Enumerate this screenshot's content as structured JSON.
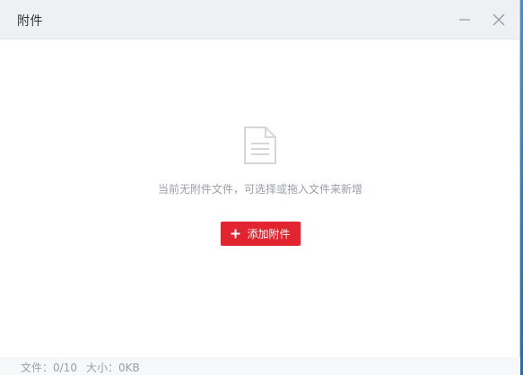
{
  "window": {
    "title": "附件",
    "minimize_icon": "minus-icon",
    "close_icon": "close-icon"
  },
  "empty_state": {
    "icon": "document-icon",
    "message": "当前无附件文件，可选择或拖入文件来新增"
  },
  "add_button": {
    "icon": "plus-icon",
    "label": "添加附件"
  },
  "footer": {
    "files": "文件：0/10",
    "size": "大小：0KB"
  },
  "colors": {
    "accent": "#e22330",
    "titlebar_bg": "#eef0f3",
    "muted_text": "#9a9ea5"
  }
}
